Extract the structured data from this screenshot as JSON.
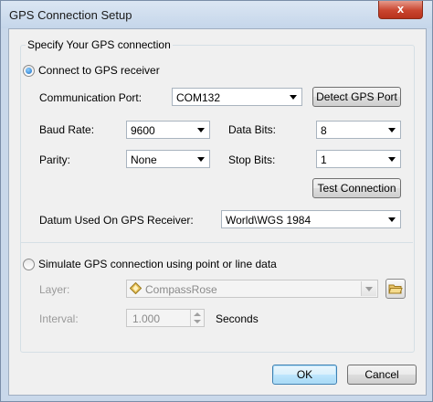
{
  "window": {
    "title": "GPS Connection Setup",
    "close_glyph": "x"
  },
  "group": {
    "legend": "Specify Your GPS connection",
    "connect_option": {
      "label": "Connect to GPS receiver",
      "selected": true,
      "communication_port": {
        "label": "Communication Port:",
        "value": "COM132",
        "detect_button": "Detect GPS Port"
      },
      "baud_rate": {
        "label": "Baud Rate:",
        "value": "9600"
      },
      "data_bits": {
        "label": "Data Bits:",
        "value": "8"
      },
      "parity": {
        "label": "Parity:",
        "value": "None"
      },
      "stop_bits": {
        "label": "Stop Bits:",
        "value": "1"
      },
      "test_button": "Test Connection",
      "datum": {
        "label": "Datum Used On GPS Receiver:",
        "value": "World\\WGS 1984"
      }
    },
    "simulate_option": {
      "label": "Simulate GPS connection using point or line data",
      "selected": false,
      "layer": {
        "label": "Layer:",
        "value": "CompassRose",
        "icon": "point-layer-icon",
        "browse_icon": "open-folder-icon"
      },
      "interval": {
        "label": "Interval:",
        "value": "1.000",
        "unit": "Seconds"
      }
    }
  },
  "buttons": {
    "ok": "OK",
    "cancel": "Cancel"
  },
  "colors": {
    "title_bar": "#c9d8ea",
    "close_button": "#c9452f",
    "dialog_bg": "#f0f0f0",
    "default_button": "#a7d9f5"
  }
}
